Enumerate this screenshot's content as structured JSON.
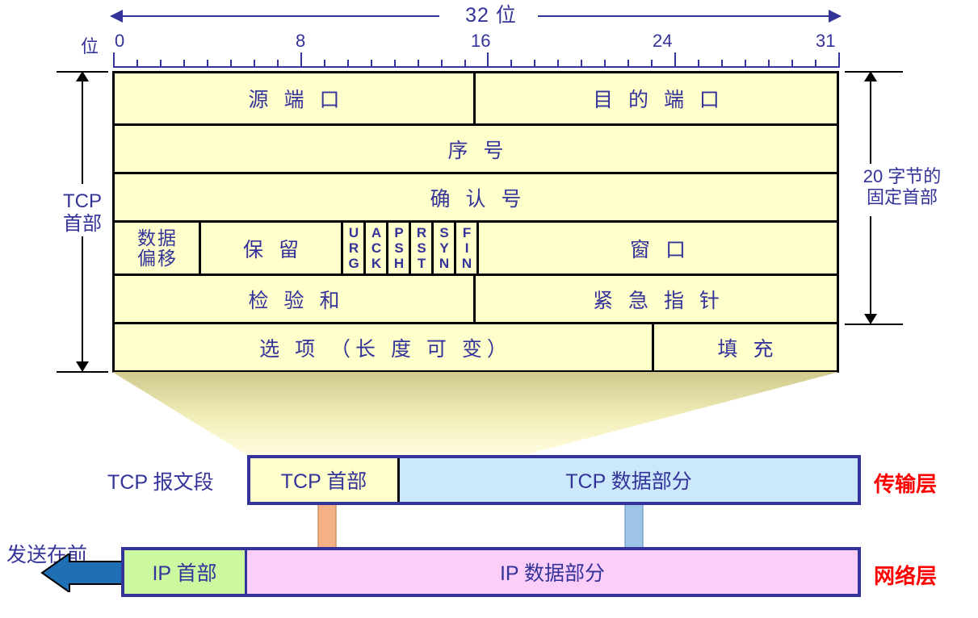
{
  "top_axis": {
    "width_label": "32 位",
    "bit_label": "位",
    "ticks": [
      "0",
      "8",
      "16",
      "24",
      "31"
    ]
  },
  "brackets": {
    "left_label_line1": "TCP",
    "left_label_line2": "首部",
    "right_label_line1": "20 字节的",
    "right_label_line2": "固定首部"
  },
  "header_rows": [
    {
      "cells": [
        {
          "label": "源 端 口"
        },
        {
          "label": "目 的 端 口"
        }
      ]
    },
    {
      "cells": [
        {
          "label": "序 号"
        }
      ]
    },
    {
      "cells": [
        {
          "label": "确 认 号"
        }
      ]
    },
    {
      "cells": [
        {
          "label_line1": "数据",
          "label_line2": "偏移"
        },
        {
          "label": "保 留"
        },
        {
          "flags": [
            "URG",
            "ACK",
            "PSH",
            "RST",
            "SYN",
            "FIN"
          ]
        },
        {
          "label": "窗 口"
        }
      ]
    },
    {
      "cells": [
        {
          "label": "检 验 和"
        },
        {
          "label": "紧 急 指 针"
        }
      ]
    },
    {
      "cells": [
        {
          "label": "选 项 （长 度 可 变）"
        },
        {
          "label": "填 充"
        }
      ]
    }
  ],
  "encapsulation": {
    "tcp_segment_label": "TCP 报文段",
    "tcp_header_box": "TCP 首部",
    "tcp_data_box": "TCP 数据部分",
    "send_first_label": "发送在前",
    "ip_header_box": "IP 首部",
    "ip_data_box": "IP 数据部分",
    "transport_layer_label": "传输层",
    "network_layer_label": "网络层"
  },
  "colors": {
    "text_blue": "#333399",
    "layer_label_red": "#ff0000",
    "header_fill": "#ffffcc",
    "tcp_data_fill": "#cce8fb",
    "ip_header_fill": "#ccf9a0",
    "ip_data_fill": "#fbcdf9",
    "orange_arrow": "#f4b183",
    "blue_arrow": "#9dc3e6",
    "send_arrow": "#1f6fb5"
  }
}
